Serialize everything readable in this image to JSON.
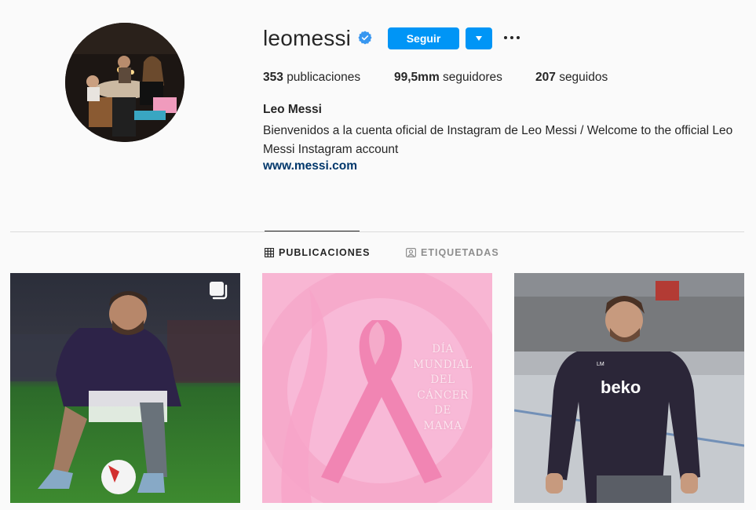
{
  "profile": {
    "username": "leomessi",
    "verified": true,
    "follow_label": "Seguir",
    "full_name": "Leo Messi",
    "bio": "Bienvenidos a la cuenta oficial de Instagram de Leo Messi / Welcome to the official Leo Messi Instagram account",
    "website": "www.messi.com"
  },
  "stats": {
    "posts_count": "353",
    "posts_label": "publicaciones",
    "followers_count": "99,5mm",
    "followers_label": "seguidores",
    "following_count": "207",
    "following_label": "seguidos"
  },
  "tabs": [
    {
      "label": "PUBLICACIONES",
      "active": true,
      "icon": "grid-icon"
    },
    {
      "label": "ETIQUETADAS",
      "active": false,
      "icon": "tagged-icon"
    }
  ],
  "posts": [
    {
      "kind": "photo",
      "multiple": true
    },
    {
      "kind": "graphic",
      "text_lines": [
        "DÍA",
        "MUNDIAL",
        "DEL",
        "CÁNCER",
        "DE",
        "MAMA"
      ]
    },
    {
      "kind": "photo",
      "shirt_text": "beko",
      "shirt_badge": "LM"
    }
  ],
  "colors": {
    "accent": "#0095f6",
    "link": "#00376b",
    "verified": "#3897f0",
    "ribbon_pink": "#f4a9c6"
  }
}
